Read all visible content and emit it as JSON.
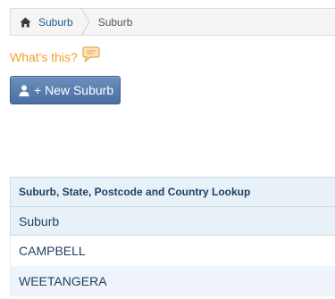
{
  "breadcrumb": {
    "home_label": "Suburb",
    "current_label": "Suburb"
  },
  "help": {
    "whats_this": "What's this?"
  },
  "actions": {
    "new_label": "+ New Suburb"
  },
  "lookup": {
    "title": "Suburb, State, Postcode and Country Lookup",
    "column": "Suburb",
    "rows": [
      "CAMPBELL",
      "WEETANGERA"
    ]
  },
  "colors": {
    "accent": "#4a6fa0",
    "link": "#1a5c8e",
    "help": "#f0a030"
  }
}
